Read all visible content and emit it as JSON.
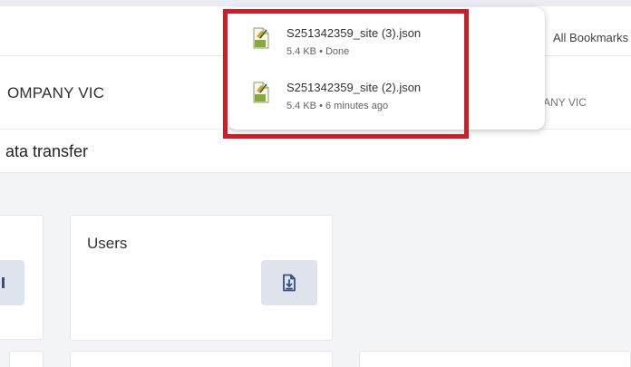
{
  "browser": {
    "bookmarks_label": "All Bookmarks"
  },
  "app": {
    "company_left": "OMPANY VIC",
    "company_right": "PANY VIC",
    "subheader_title": "ata transfer"
  },
  "cards": {
    "users_title": "Users"
  },
  "downloads": [
    {
      "name": "S251342359_site (3).json",
      "meta": "5.4 KB • Done"
    },
    {
      "name": "S251342359_site (2).json",
      "meta": "5.4 KB • 6 minutes ago"
    }
  ],
  "colors": {
    "highlight": "#c6212b",
    "icon_accent": "#384e7c",
    "icon_button_bg": "#dfe4ec"
  },
  "icons": {
    "file_icon": "json-file-icon",
    "download_icon": "download-file-icon"
  }
}
